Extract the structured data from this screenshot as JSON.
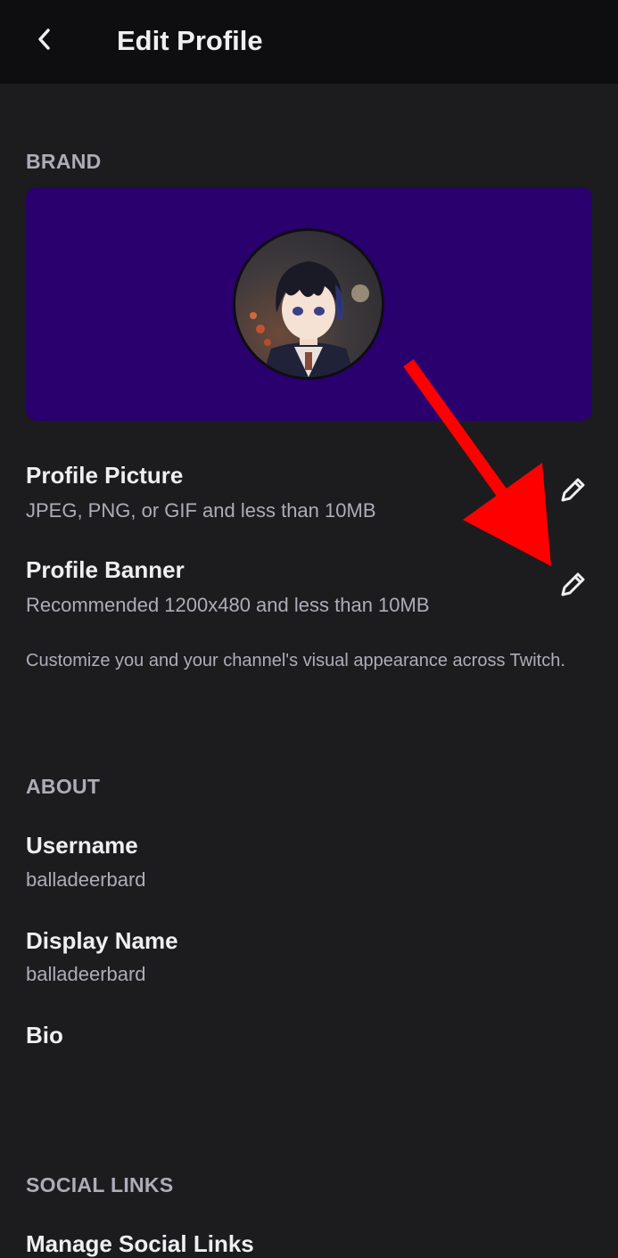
{
  "header": {
    "title": "Edit Profile",
    "back_icon": "chevron-left-icon"
  },
  "brand": {
    "section_label": "BRAND",
    "banner_color": "#2a006e",
    "profile_picture": {
      "title": "Profile Picture",
      "subtitle": "JPEG, PNG, or GIF and less than 10MB",
      "edit_icon": "pencil-icon"
    },
    "profile_banner": {
      "title": "Profile Banner",
      "subtitle": "Recommended 1200x480 and less than 10MB",
      "edit_icon": "pencil-icon"
    },
    "help_text": "Customize you and your channel's visual appearance across Twitch."
  },
  "about": {
    "section_label": "ABOUT",
    "username": {
      "label": "Username",
      "value": "balladeerbard"
    },
    "display_name": {
      "label": "Display Name",
      "value": "balladeerbard"
    },
    "bio": {
      "label": "Bio",
      "value": ""
    }
  },
  "social": {
    "section_label": "SOCIAL LINKS",
    "manage_label": "Manage Social Links"
  },
  "colors": {
    "background": "#1c1c1f",
    "header_bg": "#0e0e10",
    "annotation_arrow": "#ff0000"
  }
}
